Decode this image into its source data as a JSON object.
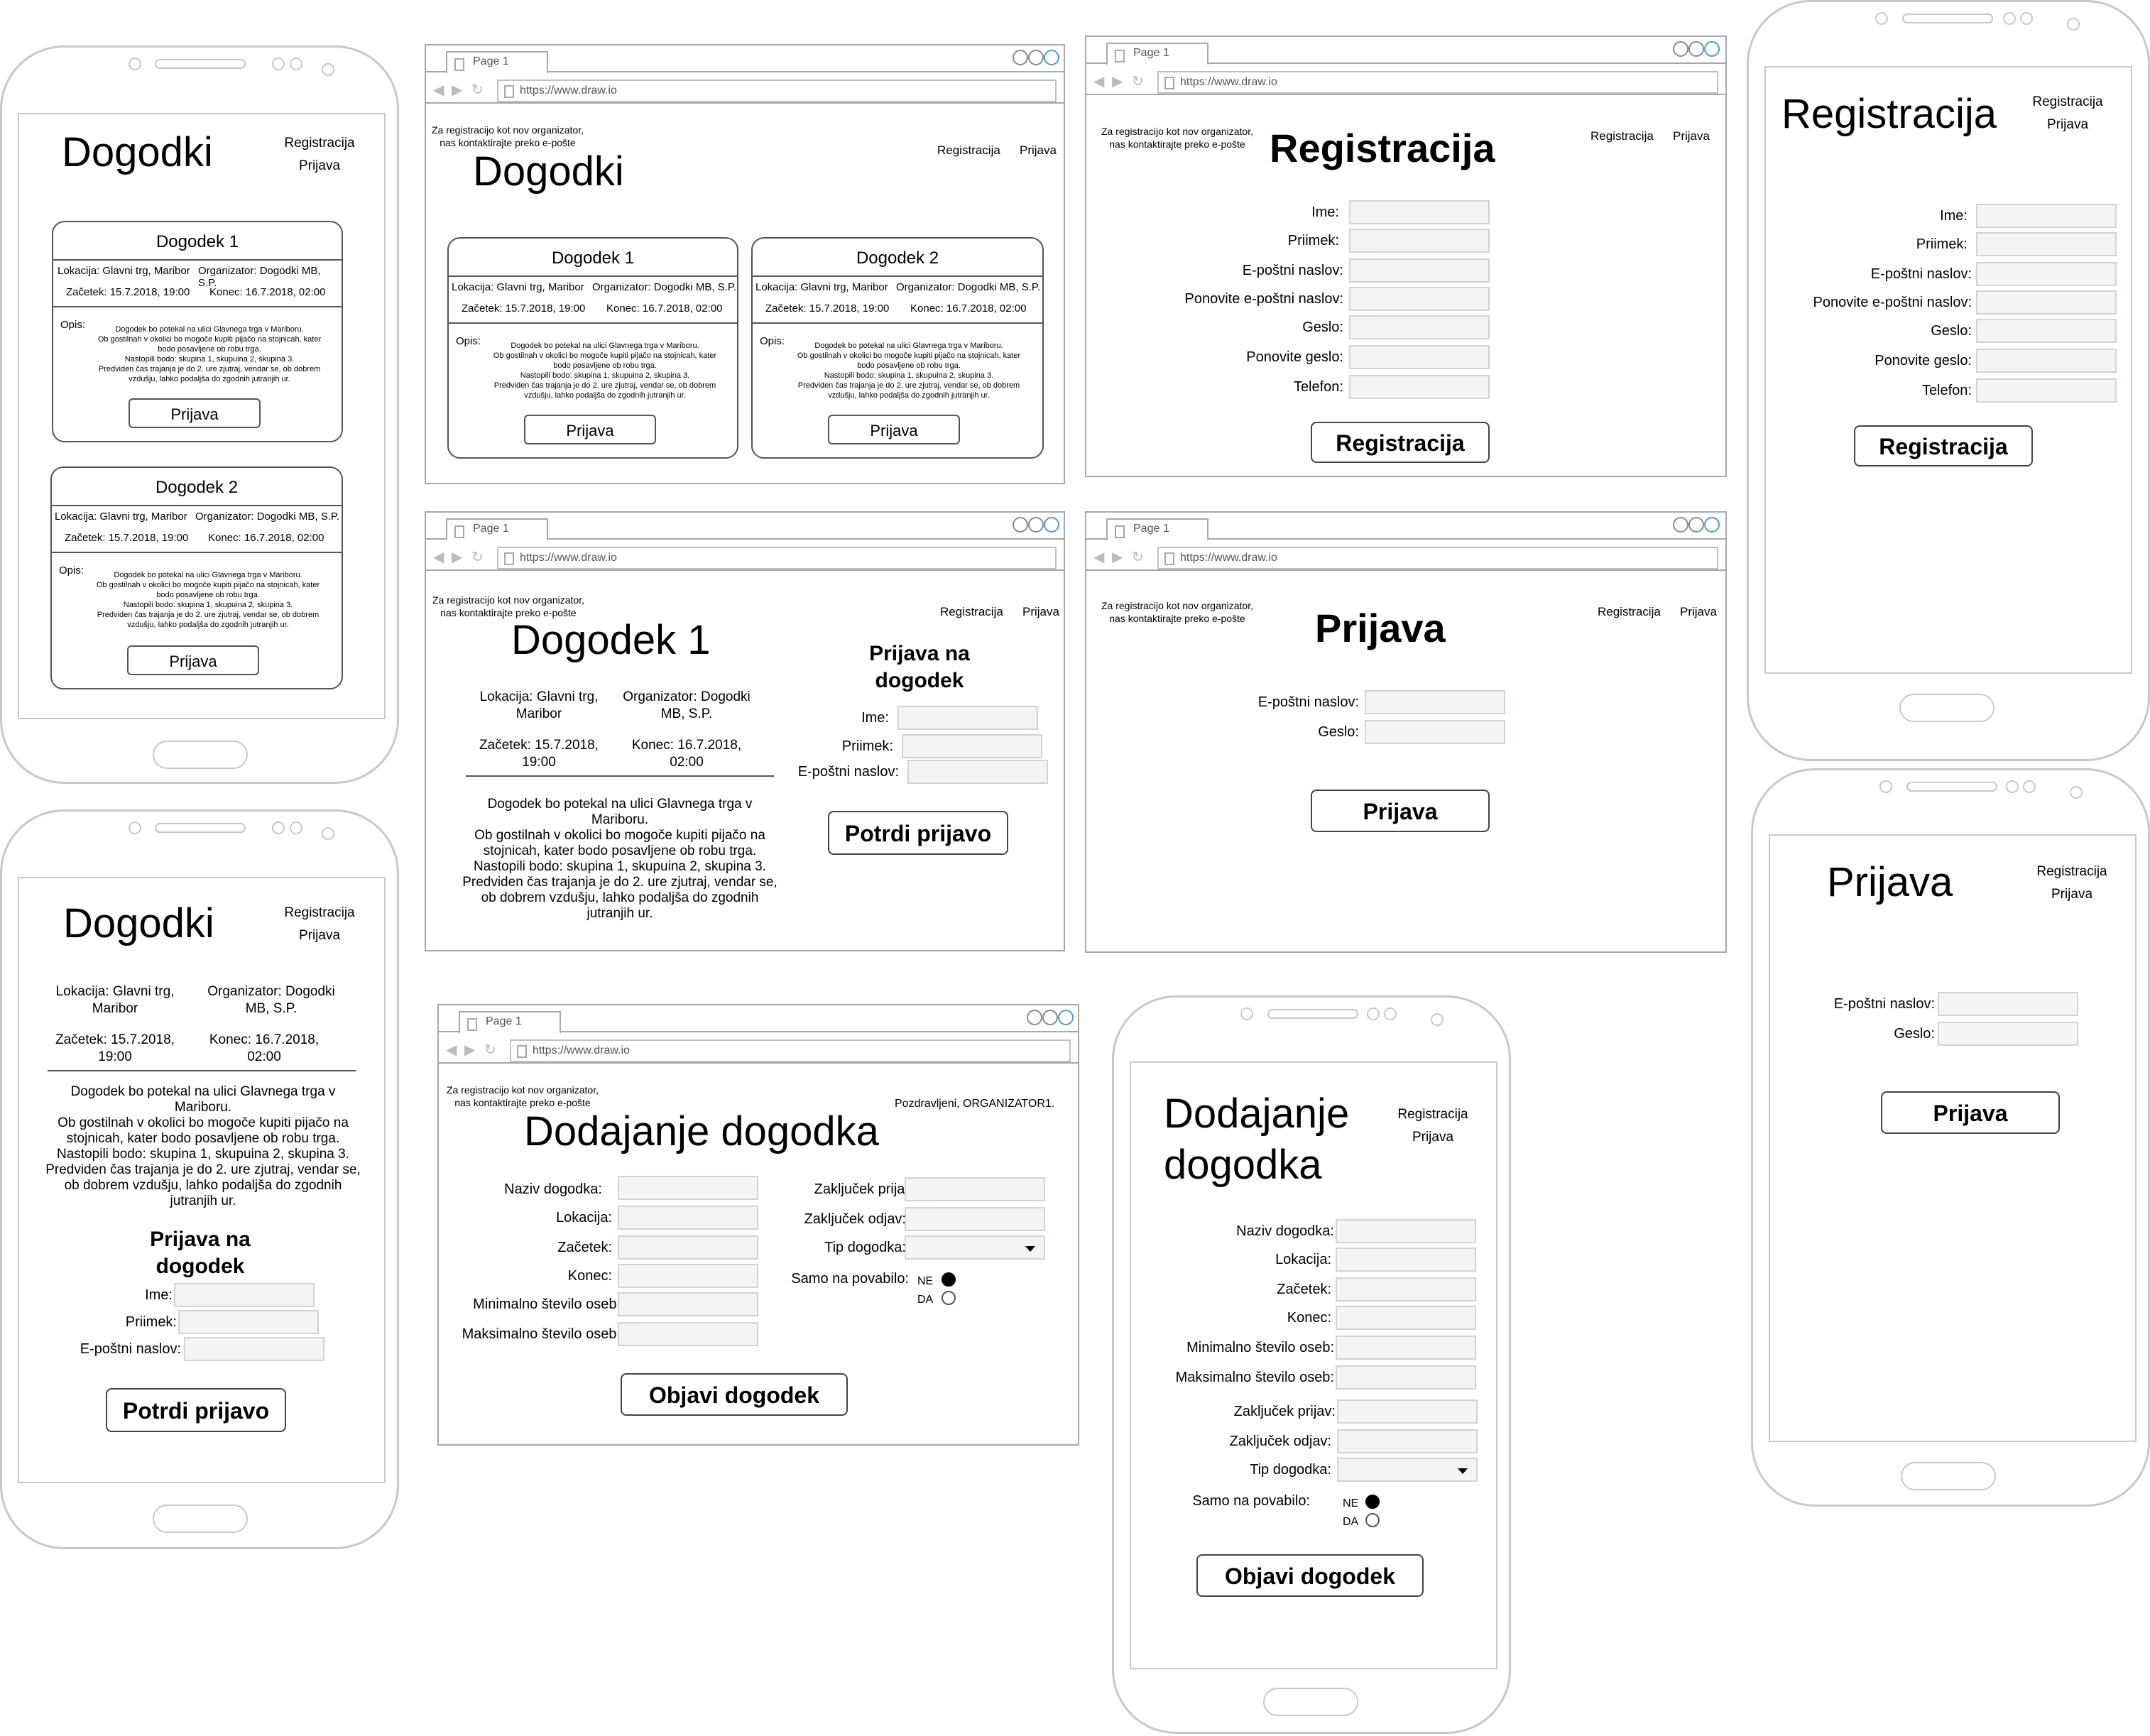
{
  "common": {
    "tab": "Page 1",
    "url": "https://www.draw.io",
    "note1": "Za registracijo kot nov organizator,",
    "note2": "nas kontaktirajte preko e-pošte",
    "note2b": "nas kontaktirajte preko e-pošte",
    "nav_reg": "Registracija",
    "nav_login": "Prijava"
  },
  "events": {
    "title": "Dogodki",
    "ev1": "Dogodek 1",
    "ev2": "Dogodek 2",
    "loc": "Lokacija: Glavni trg, Maribor",
    "org": "Organizator: Dogodki MB, S.P.",
    "start": "Začetek: 15.7.2018, 19:00",
    "end": "Konec: 16.7.2018, 02:00",
    "opis": "Opis:",
    "d1": "Dogodek bo potekal na ulici Glavnega trga v Mariboru.",
    "d2": "Ob gostilnah v okolici bo mogoče kupiti pijačo na stojnicah, kater",
    "d3": "bodo posavljene ob robu trga.",
    "d4": "Nastopili bodo: skupina 1, skupuina 2, skupina 3.",
    "d5": "Predviden čas trajanja je do 2. ure zjutraj, vendar se, ob dobrem",
    "d6": "vzdušju, lahko podaljša do zgodnih jutranjih ur.",
    "btn": "Prijava"
  },
  "detail": {
    "title": "Dogodek 1",
    "title_m": "Dogodki",
    "loc1": "Lokacija: Glavni trg,",
    "loc2": "Maribor",
    "org1": "Organizator: Dogodki",
    "org2": "MB, S.P.",
    "st1": "Začetek: 15.7.2018,",
    "st2": "19:00",
    "en1": "Konec: 16.7.2018,",
    "en2": "02:00",
    "p1": "Dogodek bo potekal na ulici Glavnega trga v",
    "p2": "Mariboru.",
    "p3": "Ob gostilnah v okolici bo mogoče kupiti pijačo na",
    "p4": "stojnicah, kater bodo posavljene ob robu trga.",
    "p5": "Nastopili bodo: skupina 1, skupuina 2, skupina 3.",
    "p6": "Predviden čas trajanja je do 2. ure zjutraj, vendar se,",
    "p7": "ob dobrem vzdušju, lahko podaljša do zgodnih",
    "p8": "jutranjih ur.",
    "form1": "Prijava na",
    "form2": "dogodek",
    "ime": "Ime:",
    "priimek": "Priimek:",
    "email": "E-poštni naslov:",
    "confirm": "Potrdi prijavo"
  },
  "register": {
    "title": "Registracija",
    "ime": "Ime:",
    "priimek": "Priimek:",
    "email": "E-poštni naslov:",
    "email2": "Ponovite e-poštni naslov:",
    "geslo": "Geslo:",
    "geslo2": "Ponovite geslo:",
    "tel": "Telefon:",
    "btn": "Registracija"
  },
  "login": {
    "title": "Prijava",
    "email": "E-poštni naslov:",
    "geslo": "Geslo:",
    "btn": "Prijava"
  },
  "add": {
    "title": "Dodajanje dogodka",
    "title_m1": "Dodajanje",
    "title_m2": "dogodka",
    "greet": "Pozdravljeni, ORGANIZATOR1.",
    "naziv": "Naziv dogodka:",
    "lok": "Lokacija:",
    "zac": "Začetek:",
    "kon": "Konec:",
    "min": "Minimalno število oseb:",
    "max": "Maksimalno število oseb:",
    "zp": "Zaključek prijav:",
    "zo": "Zaključek odjav:",
    "tip": "Tip dogodka:",
    "pov": "Samo na povabilo:",
    "ne": "NE",
    "da": "DA",
    "btn": "Objavi dogodek"
  }
}
